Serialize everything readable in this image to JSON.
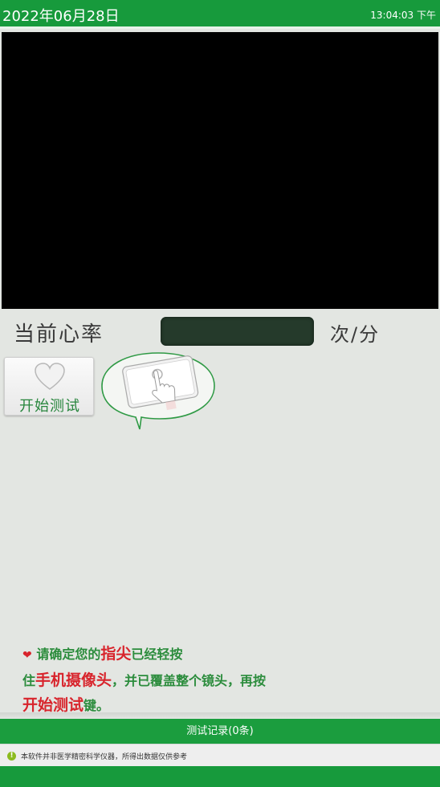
{
  "header": {
    "date": "2022年06月28日",
    "time": "13:04:03 下午"
  },
  "heart_rate": {
    "label": "当前心率",
    "label_extra": "",
    "value": "",
    "unit": "次/分"
  },
  "start_button": {
    "label": "开始测试"
  },
  "instructions": {
    "p1": "请确定您的",
    "p2": "指尖",
    "p3": "已经轻按",
    "p4": "住",
    "p5": "手机摄像头",
    "p6": "，并已覆盖整个镜头，再按",
    "p7": "开始测试",
    "p8": "键。"
  },
  "records": {
    "label": "测试记录(0条)"
  },
  "notice": {
    "text": "本软件并非医学精密科学仪器，所得出数据仅供参考"
  },
  "footer": {
    "text": ""
  },
  "colors": {
    "brand_green": "#179a3c",
    "accent_red": "#d8242c",
    "text_green": "#2b8c3c"
  }
}
